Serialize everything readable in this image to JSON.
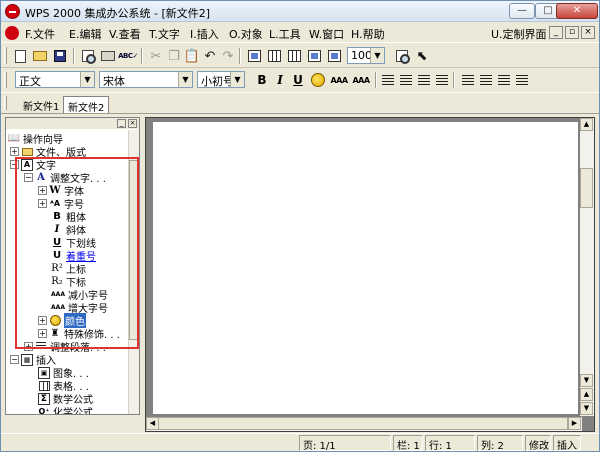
{
  "window": {
    "title": "WPS 2000 集成办公系统 - [新文件2]",
    "buttons": {
      "minimize": "—",
      "maximize": "□",
      "close": "✕"
    }
  },
  "menubar": {
    "items": [
      "F.文件",
      "E.编辑",
      "V.查看",
      "T.文字",
      "I.插入",
      "O.对象",
      "L.工具",
      "W.窗口",
      "H.帮助"
    ],
    "customize": "U.定制界面",
    "mdi": {
      "minimize": "_",
      "restore": "▫",
      "close": "×"
    }
  },
  "toolbar_standard": {
    "zoom": "100%",
    "icons": [
      "new-doc-icon",
      "open-icon",
      "save-icon",
      "print-preview-icon",
      "print-icon",
      "spellcheck-icon",
      "cut-icon",
      "copy-icon",
      "paste-icon",
      "undo-icon",
      "redo-icon",
      "insert-table-icon",
      "table-icon",
      "grid-icon",
      "frame-icon",
      "draw-icon",
      "find-icon",
      "pointer-icon"
    ]
  },
  "toolbar_format": {
    "style": "正文",
    "font": "宋体",
    "size": "小初号",
    "bold": "B",
    "italic": "I",
    "underline": "U",
    "shrink": "AAA",
    "grow": "AAA"
  },
  "doc_tabs": [
    "新文件1",
    "新文件2"
  ],
  "active_tab": "新文件2",
  "tree": {
    "root": "操作向导",
    "nodes": [
      {
        "label": "文件、版式",
        "level": 1,
        "expander": "+",
        "icon": "folder-icon"
      },
      {
        "label": "文字",
        "level": 1,
        "expander": "−",
        "icon": "text-frame-icon"
      },
      {
        "label": "调整文字. . .",
        "level": 2,
        "expander": "−",
        "icon": "A"
      },
      {
        "label": "字体",
        "level": 3,
        "expander": "+",
        "icon": "W"
      },
      {
        "label": "字号",
        "level": 3,
        "expander": "+",
        "icon": "A↑"
      },
      {
        "label": "粗体",
        "level": 3,
        "icon": "B"
      },
      {
        "label": "斜体",
        "level": 3,
        "icon": "I"
      },
      {
        "label": "下划线",
        "level": 3,
        "icon": "U"
      },
      {
        "label": "着重号",
        "level": 3,
        "icon": "U·",
        "link": true
      },
      {
        "label": "上标",
        "level": 3,
        "icon": "R²"
      },
      {
        "label": "下标",
        "level": 3,
        "icon": "R₂"
      },
      {
        "label": "减小字号",
        "level": 3,
        "icon": "AAA"
      },
      {
        "label": "增大字号",
        "level": 3,
        "icon": "AAA"
      },
      {
        "label": "颜色",
        "level": 3,
        "expander": "+",
        "icon": "color-icon",
        "selected": true
      },
      {
        "label": "特殊修饰. . .",
        "level": 3,
        "expander": "+",
        "icon": "special-icon"
      },
      {
        "label": "调整段落. . .",
        "level": 2,
        "expander": "+",
        "icon": "paragraph-icon"
      },
      {
        "label": "插入",
        "level": 1,
        "expander": "−",
        "icon": "insert-icon"
      },
      {
        "label": "图象. . .",
        "level": 2,
        "icon": "image-icon"
      },
      {
        "label": "表格. . .",
        "level": 2,
        "icon": "table-icon"
      },
      {
        "label": "数学公式",
        "level": 2,
        "icon": "Σ"
      },
      {
        "label": "化学公式",
        "level": 2,
        "icon": "chem-icon"
      }
    ]
  },
  "statusbar": {
    "page": "页: 1/1",
    "column": "栏: 1",
    "row": "行: 1",
    "col": "列: 2",
    "modify": "修改",
    "insert": "插入"
  },
  "colors": {
    "selection": "#316ac5",
    "link": "#0000ee",
    "annotation": "#e0322f"
  }
}
